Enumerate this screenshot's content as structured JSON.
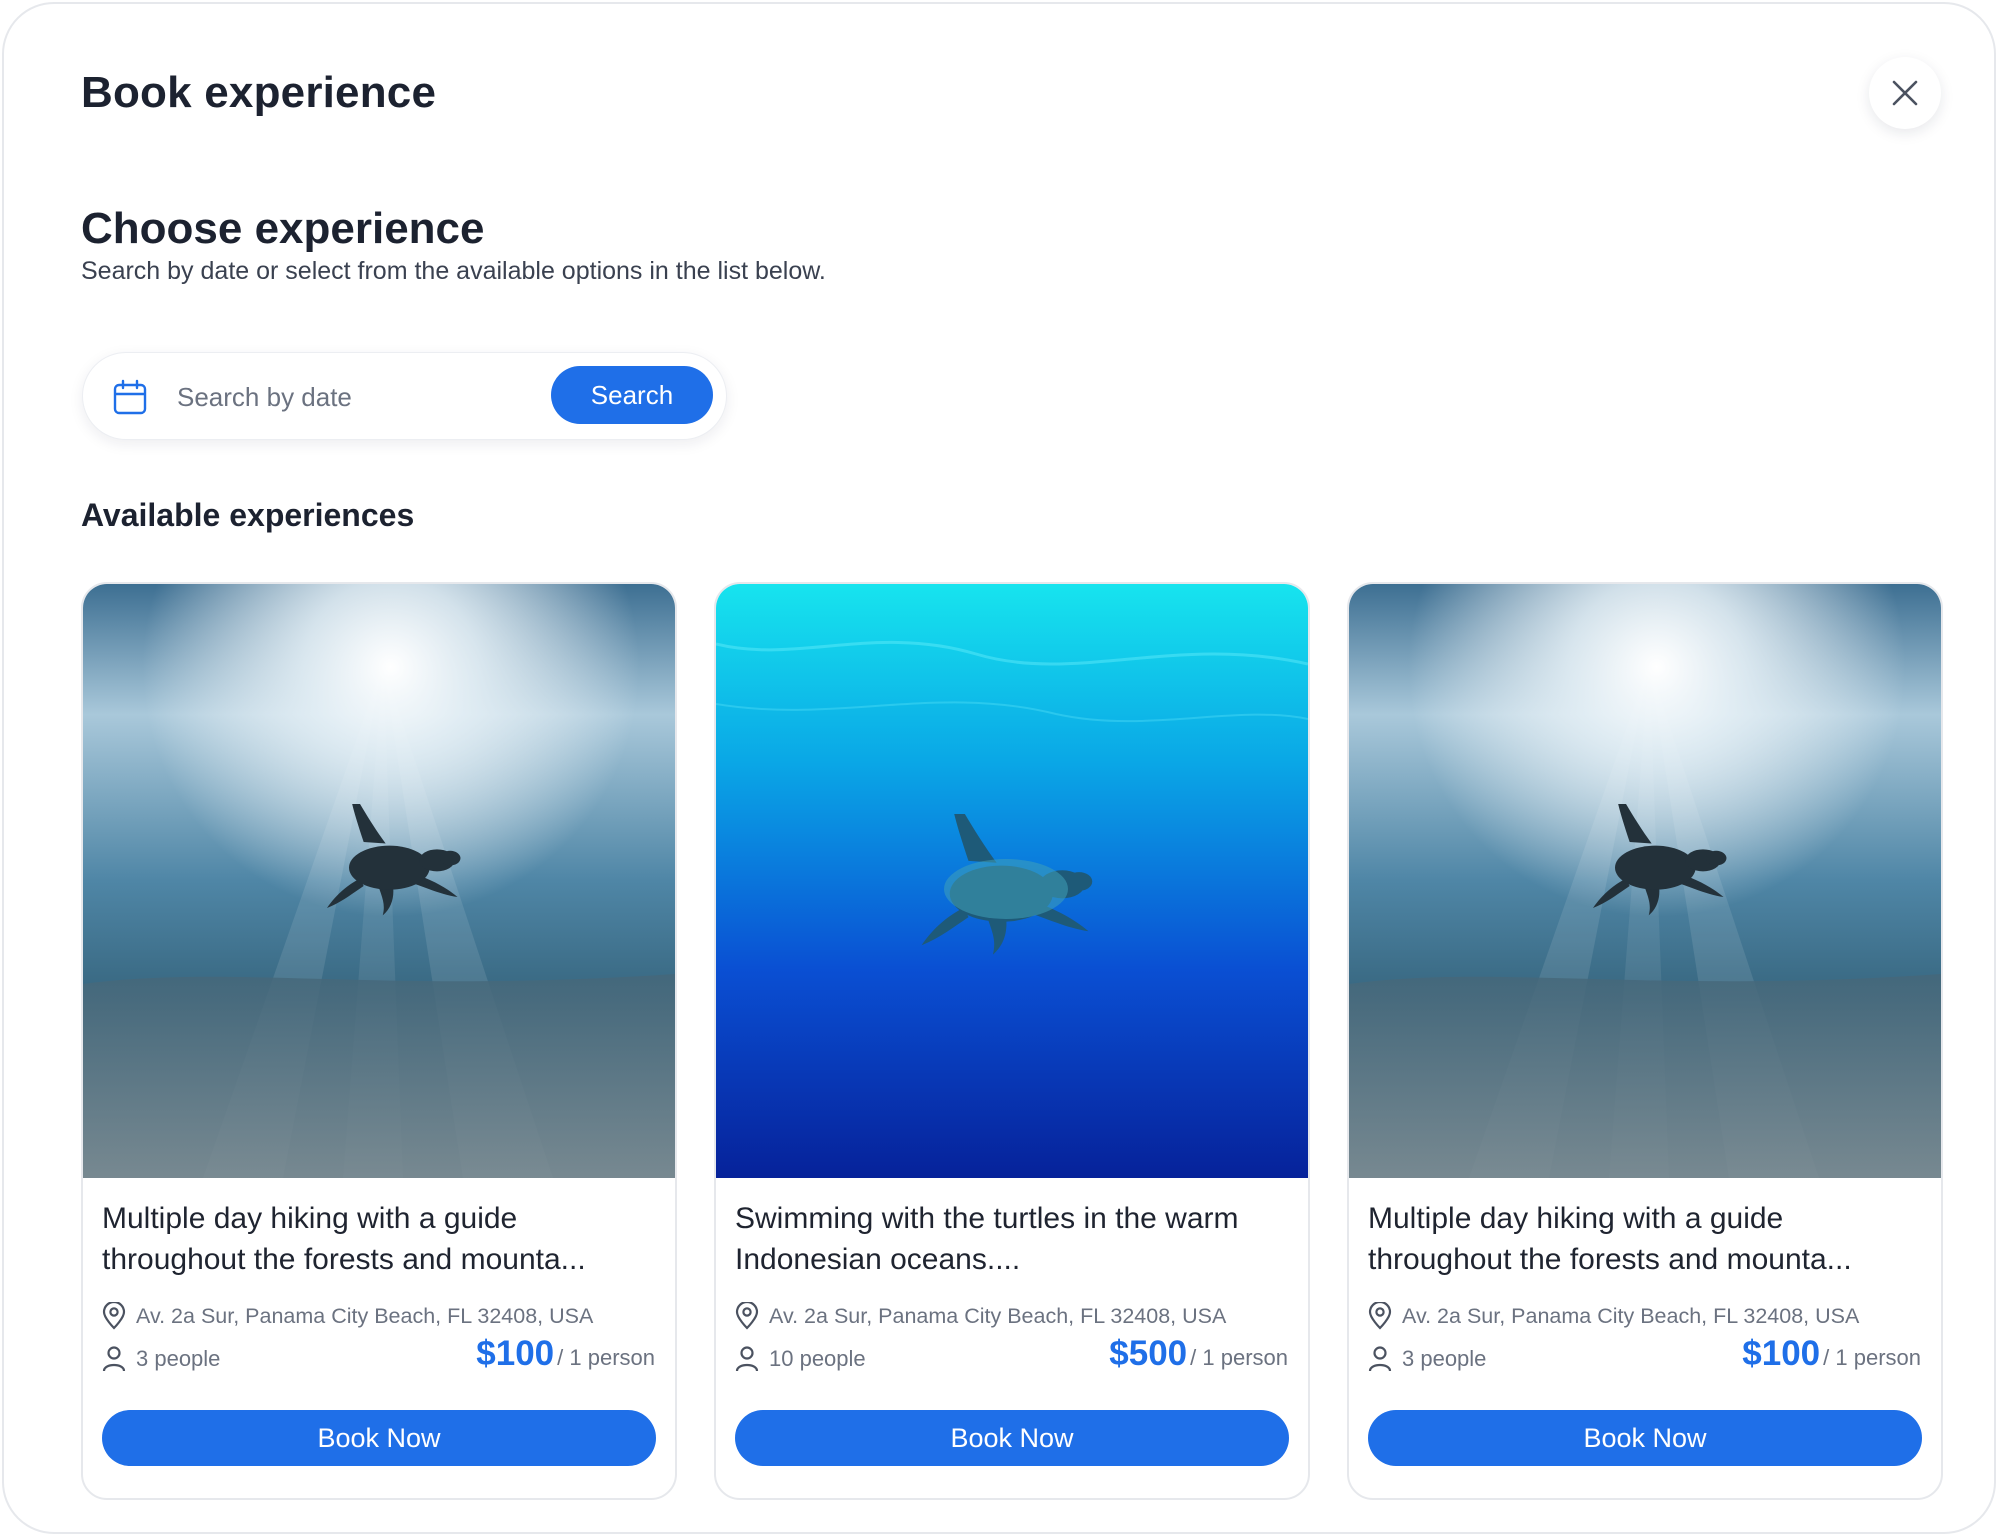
{
  "modal": {
    "title": "Book experience"
  },
  "section": {
    "title": "Choose experience",
    "subtitle": "Search by date or select from the available options in the list below."
  },
  "search": {
    "placeholder": "Search by date",
    "button_label": "Search"
  },
  "available_title": "Available experiences",
  "icons": {
    "close": "close-icon",
    "calendar": "calendar-icon",
    "location": "map-pin-icon",
    "people": "person-icon"
  },
  "colors": {
    "accent": "#1f6fe8",
    "text": "#1f2430",
    "muted": "#6b7280"
  },
  "experiences": [
    {
      "title": "Multiple day hiking with a guide throughout the forests and mounta...",
      "location": "Av. 2a Sur, Panama City Beach, FL 32408, USA",
      "people": "3 people",
      "price": "$100",
      "per": "/ 1 person",
      "button": "Book Now",
      "image": "sea-turtle-sunlit"
    },
    {
      "title": "Swimming with the turtles in the warm Indonesian oceans....",
      "location": "Av. 2a Sur, Panama City Beach, FL 32408, USA",
      "people": "10 people",
      "price": "$500",
      "per": "/ 1 person",
      "button": "Book Now",
      "image": "sea-turtle-deep-blue"
    },
    {
      "title": "Multiple day hiking with a guide throughout the forests and mounta...",
      "location": "Av. 2a Sur, Panama City Beach, FL 32408, USA",
      "people": "3 people",
      "price": "$100",
      "per": "/ 1 person",
      "button": "Book Now",
      "image": "sea-turtle-sunlit"
    }
  ]
}
